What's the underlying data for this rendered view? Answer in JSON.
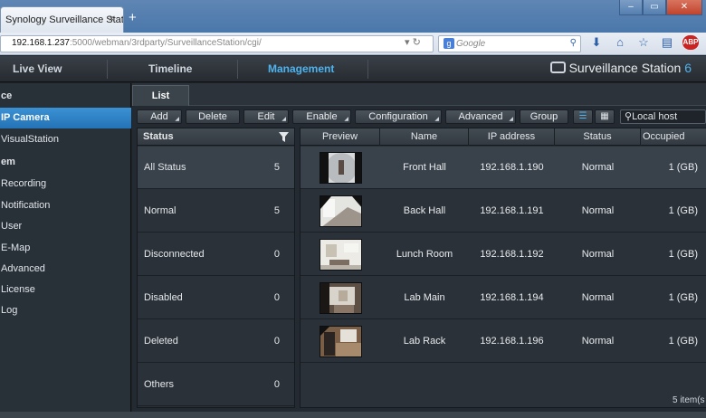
{
  "browser": {
    "tab_title": "Synology Surveillance Statio...",
    "tab_close": "×",
    "new_tab": "+",
    "url_host": "192.168.1.237",
    "url_rest": ":5000/webman/3rdparty/SurveillanceStation/cgi/",
    "search_placeholder": "Google"
  },
  "nav": {
    "tabs": [
      "Live View",
      "Timeline",
      "Management"
    ],
    "active": "Management",
    "brand": "Surveillance Station",
    "brand_version": "6"
  },
  "sidebar": {
    "items": [
      {
        "label": "ce",
        "kind": "group"
      },
      {
        "label": "IP Camera",
        "kind": "active"
      },
      {
        "label": "VisualStation",
        "kind": "item"
      },
      {
        "label": "em",
        "kind": "group"
      },
      {
        "label": "Recording",
        "kind": "item"
      },
      {
        "label": "Notification",
        "kind": "item"
      },
      {
        "label": "User",
        "kind": "item"
      },
      {
        "label": "E-Map",
        "kind": "item"
      },
      {
        "label": "Advanced",
        "kind": "item"
      },
      {
        "label": "License",
        "kind": "item"
      },
      {
        "label": "Log",
        "kind": "item"
      }
    ]
  },
  "subtab": "List",
  "toolbar": {
    "buttons": [
      {
        "label": "Add",
        "dropdown": true
      },
      {
        "label": "Delete",
        "dropdown": false
      },
      {
        "label": "Edit",
        "dropdown": true
      },
      {
        "label": "Enable",
        "dropdown": true
      },
      {
        "label": "Configuration",
        "dropdown": true
      },
      {
        "label": "Advanced",
        "dropdown": true
      },
      {
        "label": "Group",
        "dropdown": false
      }
    ],
    "host_search": "Local host"
  },
  "status_panel": {
    "title": "Status",
    "rows": [
      {
        "label": "All Status",
        "count": "5"
      },
      {
        "label": "Normal",
        "count": "5"
      },
      {
        "label": "Disconnected",
        "count": "0"
      },
      {
        "label": "Disabled",
        "count": "0"
      },
      {
        "label": "Deleted",
        "count": "0"
      },
      {
        "label": "Others",
        "count": "0"
      }
    ]
  },
  "camera_table": {
    "columns": [
      "Preview",
      "Name",
      "IP address",
      "Status",
      "Occupied"
    ],
    "rows": [
      {
        "name": "Front Hall",
        "ip": "192.168.1.190",
        "status": "Normal",
        "occupied": "1 (GB)"
      },
      {
        "name": "Back Hall",
        "ip": "192.168.1.191",
        "status": "Normal",
        "occupied": "1 (GB)"
      },
      {
        "name": "Lunch Room",
        "ip": "192.168.1.192",
        "status": "Normal",
        "occupied": "1 (GB)"
      },
      {
        "name": "Lab Main",
        "ip": "192.168.1.194",
        "status": "Normal",
        "occupied": "1 (GB)"
      },
      {
        "name": "Lab Rack",
        "ip": "192.168.1.196",
        "status": "Normal",
        "occupied": "1 (GB)"
      }
    ],
    "footer": "5 item(s"
  },
  "colors": {
    "accent": "#4fb3ee",
    "sidebar_active": "#2a7fc3",
    "panel": "#2a3138"
  }
}
